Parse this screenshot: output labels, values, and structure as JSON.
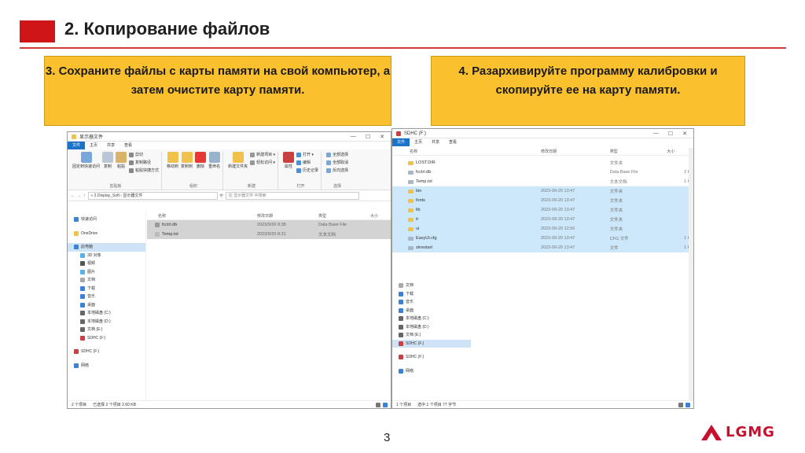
{
  "slide": {
    "title": "2. Копирование файлов",
    "callout_left": "3. Сохраните файлы с карты памяти на свой компьютер, а затем очистите карту памяти.",
    "callout_right": "4. Разархивируйте программу калибровки и скопируйте ее на карту памяти.",
    "page_number": "3",
    "logo": "LGMG",
    "colors": {
      "accent_red": "#cf1518",
      "callout_yellow": "#fbc02d",
      "selection_blue": "#cde8fb"
    }
  },
  "left_window": {
    "title": "显示器文件",
    "tabs": [
      "文件",
      "主页",
      "共享",
      "查看"
    ],
    "ribbon": {
      "clipboard": [
        "固定到快速访问",
        "复制",
        "粘贴"
      ],
      "clipboard_small": [
        "剪切",
        "复制路径",
        "粘贴快捷方式"
      ],
      "organize": [
        "移动到",
        "复制到",
        "删除",
        "重命名"
      ],
      "new_folder": "新建文件夹",
      "new_small": [
        "新建项目 ▾",
        "轻松访问 ▾"
      ],
      "properties": "属性",
      "open_small": [
        "打开 ▾",
        "编辑",
        "历史记录"
      ],
      "select_small": [
        "全部选择",
        "全部取消",
        "反向选择"
      ],
      "groups": [
        "剪贴板",
        "组织",
        "新建",
        "打开",
        "选择"
      ]
    },
    "path": "« 2.Display_Soft › 显示器文件",
    "search_placeholder": "在 显示器文件 中搜索",
    "columns": [
      "名称",
      "修改日期",
      "类型",
      "大小"
    ],
    "nav": [
      "快速访问",
      "OneDrive",
      "此电脑",
      "3D 对象",
      "视频",
      "图片",
      "文档",
      "下载",
      "音乐",
      "桌面",
      "本地磁盘 (C:)",
      "本地磁盘 (D:)",
      "文档 (E:)",
      "SDHC (F:)",
      "SDHC (F:)",
      "网络"
    ],
    "files": [
      {
        "name": "fcctrl.db",
        "date": "2023/9/20 8:38",
        "type": "Data Base File"
      },
      {
        "name": "Temp.txt",
        "date": "2023/9/20 8:31",
        "type": "文本文档"
      }
    ],
    "status": [
      "2 个项目",
      "已选择 2 个项目 2.60 KB"
    ]
  },
  "right_window": {
    "title": "SDHC (F:)",
    "tabs": [
      "文件",
      "主页",
      "共享",
      "查看"
    ],
    "columns": [
      "名称",
      "修改日期",
      "类型",
      "大小"
    ],
    "files": [
      {
        "name": "LOST.DIR",
        "date": "",
        "type": "文件夹",
        "size": ""
      },
      {
        "name": "fcctrl.db",
        "date": "",
        "type": "Data Base File",
        "size": "2 KB"
      },
      {
        "name": "Temp.txt",
        "date": "",
        "type": "文本文档",
        "size": "1 KB"
      },
      {
        "name": "bin",
        "date": "2023-09-20 13:47",
        "type": "文件夹",
        "size": ""
      },
      {
        "name": "fonts",
        "date": "2023-09-20 13:47",
        "type": "文件夹",
        "size": ""
      },
      {
        "name": "lib",
        "date": "2023-09-20 13:47",
        "type": "文件夹",
        "size": ""
      },
      {
        "name": "tr",
        "date": "2023-09-20 13:47",
        "type": "文件夹",
        "size": ""
      },
      {
        "name": "ui",
        "date": "2023-09-20 12:56",
        "type": "文件夹",
        "size": ""
      },
      {
        "name": "EasyUI.cfg",
        "date": "2023-09-20 13:47",
        "type": "CFG 文件",
        "size": "1 KB"
      },
      {
        "name": "zkrestart",
        "date": "2023-09-20 13:47",
        "type": "文件",
        "size": "1 KB"
      }
    ],
    "nav": [
      "文档",
      "下载",
      "音乐",
      "桌面",
      "本地磁盘 (C:)",
      "本地磁盘 (D:)",
      "文档 (E:)",
      "SDHC (F:)",
      "SDHC (F:)",
      "网络"
    ],
    "status": [
      "1 个项目",
      "选中 1 个项目 77 字节"
    ]
  }
}
